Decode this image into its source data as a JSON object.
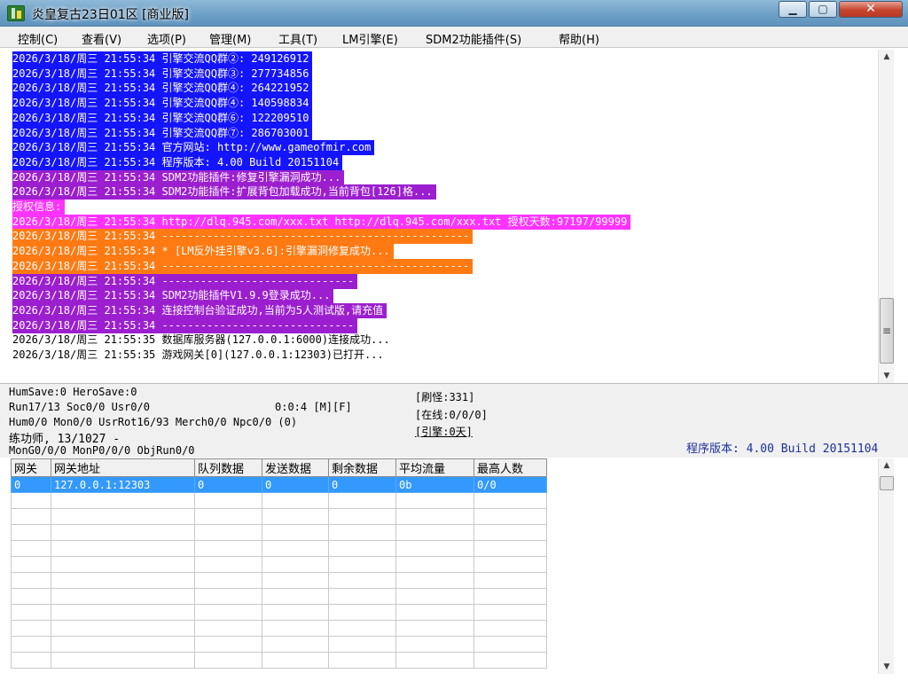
{
  "window": {
    "title": "炎皇复古23日01区 [商业版]",
    "close": "✕",
    "minimize": "▁",
    "maximize": "▢"
  },
  "menu": [
    "控制(C)",
    "查看(V)",
    "选项(P)",
    "管理(M)",
    "工具(T)",
    "LM引擎(E)",
    "SDM2功能插件(S)",
    "帮助(H)"
  ],
  "log": [
    {
      "text": "2026/3/18/周三 21:55:34 引擎交流QQ群②: 249126912",
      "color": "blue"
    },
    {
      "text": "2026/3/18/周三 21:55:34 引擎交流QQ群③: 277734856",
      "color": "blue"
    },
    {
      "text": "2026/3/18/周三 21:55:34 引擎交流QQ群④: 264221952",
      "color": "blue"
    },
    {
      "text": "2026/3/18/周三 21:55:34 引擎交流QQ群④: 140598834",
      "color": "blue"
    },
    {
      "text": "2026/3/18/周三 21:55:34 引擎交流QQ群⑥: 122209510",
      "color": "blue"
    },
    {
      "text": "2026/3/18/周三 21:55:34 引擎交流QQ群⑦: 286703001",
      "color": "blue"
    },
    {
      "text": "2026/3/18/周三 21:55:34 官方网站: http://www.gameofmir.com",
      "color": "blue"
    },
    {
      "text": "2026/3/18/周三 21:55:34 程序版本: 4.00 Build 20151104",
      "color": "blue"
    },
    {
      "text": "2026/3/18/周三 21:55:34 SDM2功能插件:修复引擎漏洞成功...",
      "color": "purple"
    },
    {
      "text": "2026/3/18/周三 21:55:34 SDM2功能插件:扩展背包加载成功,当前背包[126]格...",
      "color": "purple"
    },
    {
      "text": "授权信息:",
      "color": "magenta"
    },
    {
      "text": "2026/3/18/周三 21:55:34 http://dlq.945.com/xxx.txt http://dlq.945.com/xxx.txt 授权天数:97197/99999",
      "color": "magenta"
    },
    {
      "text": "2026/3/18/周三 21:55:34 ------------------------------------------------",
      "color": "orange"
    },
    {
      "text": "2026/3/18/周三 21:55:34 * [LM反外挂引擎v3.6]:引擎漏洞修复成功...",
      "color": "orange"
    },
    {
      "text": "2026/3/18/周三 21:55:34 ------------------------------------------------",
      "color": "orange"
    },
    {
      "text": "2026/3/18/周三 21:55:34 ------------------------------",
      "color": "purple"
    },
    {
      "text": "2026/3/18/周三 21:55:34 SDM2功能插件V1.9.9登录成功...",
      "color": "purple"
    },
    {
      "text": "2026/3/18/周三 21:55:34 连接控制台验证成功,当前为5人测试版,请充值",
      "color": "purple"
    },
    {
      "text": "2026/3/18/周三 21:55:34 ------------------------------",
      "color": "purple"
    },
    {
      "text": "2026/3/18/周三 21:55:35 数据库服务器(127.0.0.1:6000)连接成功...",
      "color": "plain"
    },
    {
      "text": "2026/3/18/周三 21:55:35 游戏网关[0](127.0.0.1:12303)已打开...",
      "color": "plain"
    }
  ],
  "status": {
    "l1": "HumSave:0 HeroSave:0",
    "l2a": "Run17/13 Soc0/0 Usr0/0",
    "l2b": "0:0:4 [M][F]",
    "l3": "Hum0/0 Mon0/0 UsrRot16/93 Merch0/0 Npc0/0 (0)",
    "l4": "练功师, 13/1027 -",
    "l5": "MonG0/0/0 MonP0/0/0 ObjRun0/0",
    "r1": "[刷怪:331]",
    "r2": "[在线:0/0/0]",
    "r3": "[引擎:0天]",
    "version": "程序版本: 4.00 Build 20151104"
  },
  "grid": {
    "headers": [
      "网关",
      "网关地址",
      "队列数据",
      "发送数据",
      "剩余数据",
      "平均流量",
      "最高人数"
    ],
    "rows": [
      [
        "0",
        "127.0.0.1:12303",
        "0",
        "0",
        "0",
        "0b",
        "0/0"
      ]
    ]
  },
  "icons": {
    "scroll_up": "▲",
    "scroll_down": "▼",
    "grip": "≡"
  }
}
